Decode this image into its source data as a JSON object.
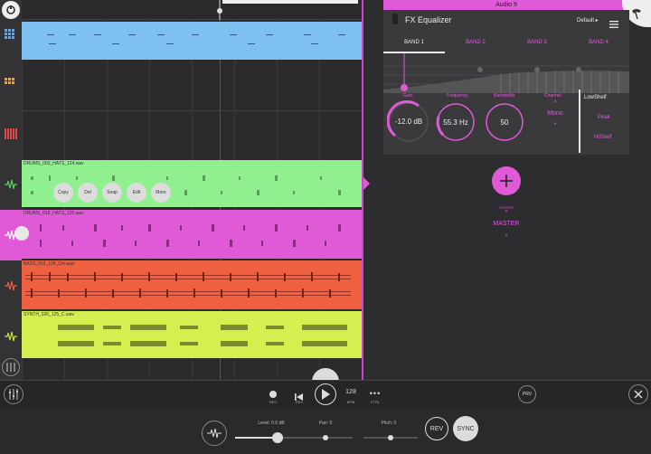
{
  "fx": {
    "track_title": "Audio 9",
    "panel_title": "FX Equalizer",
    "preset": "Default ▸",
    "bands": [
      "BAND 1",
      "BAND 2",
      "BAND 3",
      "BAND 4"
    ],
    "knobs": {
      "gain": {
        "label": "Gain",
        "value": "-12.0 dB"
      },
      "frequency": {
        "label": "Frequency",
        "value": "55.3 Hz"
      },
      "bandwidth": {
        "label": "Bandwidth",
        "value": "50"
      },
      "channel": {
        "label": "Channel",
        "value": "Mono"
      }
    },
    "filter_types": [
      "LowShelf",
      "Peak",
      "HiShelf"
    ],
    "output_label": "OUTPUT",
    "output_value": "MASTER"
  },
  "clips": [
    {
      "name": "DRUMS_003_HATS_124.wav",
      "color": "#90f090"
    },
    {
      "name": "DRUMS_018_HATS_120.wav",
      "color": "#e05ad8"
    },
    {
      "name": "BASS_010_124_Cm.wav",
      "color": "#ee6040"
    },
    {
      "name": "SYNTH_026_125_C.wav",
      "color": "#d7ee50"
    }
  ],
  "context_menu": [
    "Copy",
    "Del",
    "Snap",
    "Edit",
    "More"
  ],
  "transport": {
    "rec": "REC",
    "rev": "REV",
    "bpm_value": "128",
    "bpm_label": "BPM",
    "ctrl": "CTRL",
    "prv": "PRV"
  },
  "mixer": {
    "level": "Level: 0.0 dB",
    "pan": "Pan: 0",
    "pitch": "Pitch: 0",
    "rev_button": "REV",
    "sync_button": "SYNC"
  },
  "colors": {
    "accent": "#e05ad8",
    "blue_clip": "#7ec0f0",
    "green": "#90f090",
    "orange": "#ee6040",
    "yellow": "#d7ee50"
  }
}
